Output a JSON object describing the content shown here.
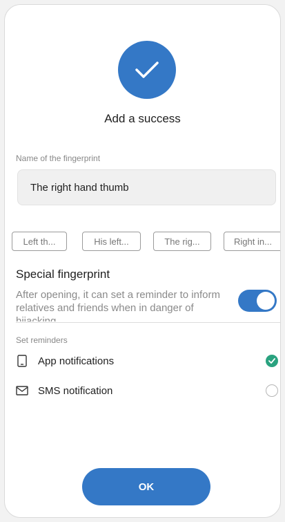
{
  "header": {
    "title": "Add a success"
  },
  "name_field": {
    "label": "Name of the fingerprint",
    "value": "The right hand thumb"
  },
  "suggestion_chips": [
    {
      "label": "Left th..."
    },
    {
      "label": "His left..."
    },
    {
      "label": "The rig..."
    },
    {
      "label": "Right in..."
    }
  ],
  "special": {
    "title": "Special fingerprint",
    "description": "After opening, it can set a reminder to inform relatives and friends when in danger of hijacking",
    "toggle_on": true
  },
  "reminders": {
    "label": "Set reminders",
    "options": [
      {
        "label": "App notifications",
        "icon": "phone-icon",
        "selected": true
      },
      {
        "label": "SMS notification",
        "icon": "mail-icon",
        "selected": false
      }
    ]
  },
  "footer": {
    "ok_label": "OK"
  },
  "colors": {
    "accent": "#3478c6",
    "check_green": "#2aa27f"
  }
}
